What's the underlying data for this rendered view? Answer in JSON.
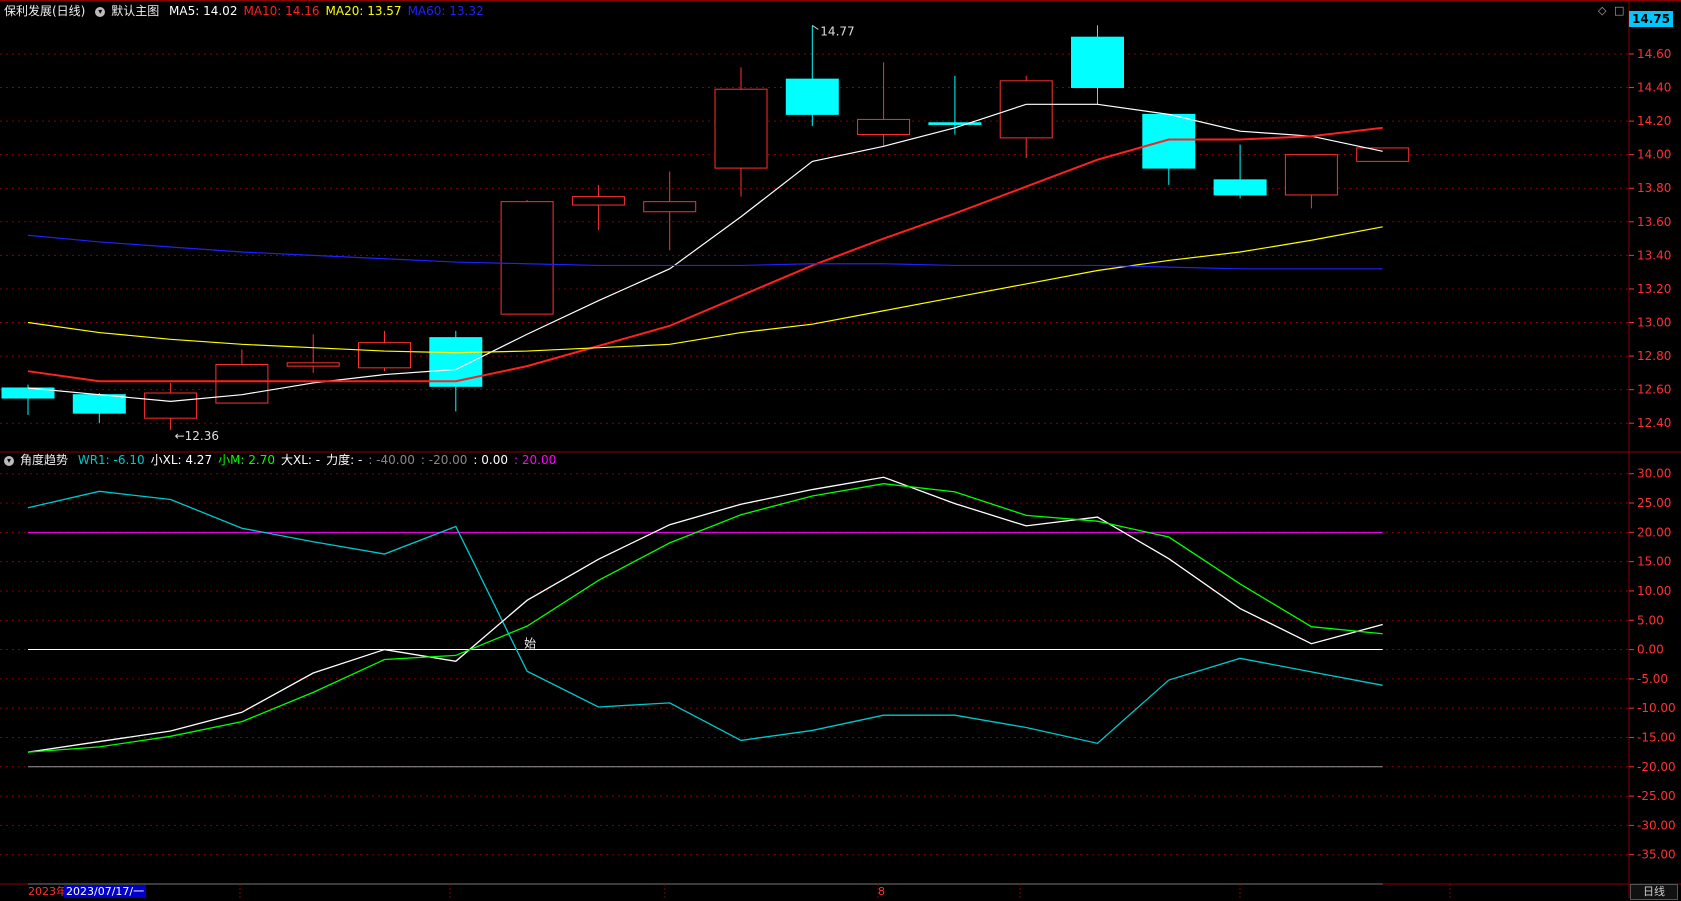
{
  "main_panel": {
    "title": "保利发展(日线)",
    "template_label": "默认主图",
    "indicators": [
      {
        "label": "MA5: 14.02",
        "color": "#ffffff"
      },
      {
        "label": "MA10: 14.16",
        "color": "#ff2020"
      },
      {
        "label": "MA20: 13.57",
        "color": "#ffff00"
      },
      {
        "label": "MA60: 13.32",
        "color": "#2020ff"
      }
    ],
    "price_tag": "14.75",
    "high_marker": "14.77",
    "low_marker": "12.36"
  },
  "sub_panel": {
    "title": "角度趋势",
    "indicators": [
      {
        "label": "WR1: -6.10",
        "color": "#00c8c8"
      },
      {
        "label": "小XL: 4.27",
        "color": "#ffffff"
      },
      {
        "label": "小M: 2.70",
        "color": "#00ff00"
      },
      {
        "label": "大XL: -",
        "color": "#ffffff"
      },
      {
        "label": "力度: -",
        "color": "#ffffff"
      },
      {
        "label": ": -40.00",
        "color": "#888888"
      },
      {
        "label": ": -20.00",
        "color": "#888888"
      },
      {
        "label": ": 0.00",
        "color": "#ffffff"
      },
      {
        "label": ": 20.00",
        "color": "#ff00ff"
      }
    ],
    "start_marker": "始"
  },
  "bottom": {
    "year": "2023年",
    "selected_date": "2023/07/17/一",
    "month_marker": "8",
    "tab": "日线"
  },
  "colors": {
    "up": "#ff3030",
    "down": "#00ffff",
    "grid": "#8b0000",
    "axis_text": "#ff3030"
  },
  "chart_data": [
    {
      "type": "candlestick",
      "title": "保利发展(日线)",
      "ylim": [
        12.3,
        14.85
      ],
      "yticks": [
        12.4,
        12.6,
        12.8,
        13.0,
        13.2,
        13.4,
        13.6,
        13.8,
        14.0,
        14.2,
        14.4,
        14.6
      ],
      "ytick_labels": [
        "12.40",
        "12.60",
        "12.80",
        "13.00",
        "13.20",
        "13.40",
        "13.60",
        "13.80",
        "14.00",
        "14.20",
        "14.40",
        "14.60"
      ],
      "candles": [
        {
          "o": 12.61,
          "h": 12.63,
          "l": 12.45,
          "c": 12.55
        },
        {
          "o": 12.57,
          "h": 12.58,
          "l": 12.4,
          "c": 12.46
        },
        {
          "o": 12.43,
          "h": 12.64,
          "l": 12.36,
          "c": 12.58
        },
        {
          "o": 12.52,
          "h": 12.84,
          "l": 12.52,
          "c": 12.75
        },
        {
          "o": 12.74,
          "h": 12.93,
          "l": 12.7,
          "c": 12.76
        },
        {
          "o": 12.73,
          "h": 12.95,
          "l": 12.71,
          "c": 12.88
        },
        {
          "o": 12.91,
          "h": 12.95,
          "l": 12.47,
          "c": 12.62
        },
        {
          "o": 13.05,
          "h": 13.73,
          "l": 13.05,
          "c": 13.72
        },
        {
          "o": 13.7,
          "h": 13.82,
          "l": 13.55,
          "c": 13.75
        },
        {
          "o": 13.66,
          "h": 13.9,
          "l": 13.43,
          "c": 13.72
        },
        {
          "o": 13.92,
          "h": 14.52,
          "l": 13.75,
          "c": 14.39
        },
        {
          "o": 14.45,
          "h": 14.77,
          "l": 14.17,
          "c": 14.24
        },
        {
          "o": 14.12,
          "h": 14.55,
          "l": 14.05,
          "c": 14.21
        },
        {
          "o": 14.19,
          "h": 14.47,
          "l": 14.12,
          "c": 14.18
        },
        {
          "o": 14.1,
          "h": 14.47,
          "l": 13.98,
          "c": 14.44
        },
        {
          "o": 14.7,
          "h": 14.77,
          "l": 14.3,
          "c": 14.4
        },
        {
          "o": 14.24,
          "h": 14.24,
          "l": 13.82,
          "c": 13.92
        },
        {
          "o": 13.85,
          "h": 14.06,
          "l": 13.74,
          "c": 13.76
        },
        {
          "o": 13.76,
          "h": 14.0,
          "l": 13.68,
          "c": 14.0
        },
        {
          "o": 13.96,
          "h": 14.04,
          "l": 13.96,
          "c": 14.04
        }
      ],
      "series": [
        {
          "name": "MA5",
          "color": "#ffffff",
          "values": [
            12.61,
            12.57,
            12.53,
            12.57,
            12.64,
            12.69,
            12.72,
            12.93,
            13.13,
            13.32,
            13.63,
            13.96,
            14.05,
            14.16,
            14.3,
            14.3,
            14.24,
            14.14,
            14.11,
            14.02
          ]
        },
        {
          "name": "MA10",
          "color": "#ff2020",
          "values": [
            12.71,
            12.65,
            12.65,
            12.65,
            12.65,
            12.65,
            12.65,
            12.74,
            12.86,
            12.98,
            13.16,
            13.34,
            13.5,
            13.65,
            13.81,
            13.97,
            14.09,
            14.09,
            14.11,
            14.16
          ]
        },
        {
          "name": "MA20",
          "color": "#ffff00",
          "values": [
            13.0,
            12.94,
            12.9,
            12.87,
            12.85,
            12.83,
            12.82,
            12.83,
            12.85,
            12.87,
            12.94,
            12.99,
            13.07,
            13.15,
            13.23,
            13.31,
            13.37,
            13.42,
            13.49,
            13.57
          ]
        },
        {
          "name": "MA60",
          "color": "#2020ff",
          "values": [
            13.52,
            13.48,
            13.45,
            13.42,
            13.4,
            13.38,
            13.36,
            13.35,
            13.34,
            13.34,
            13.34,
            13.35,
            13.35,
            13.34,
            13.34,
            13.34,
            13.33,
            13.32,
            13.32,
            13.32
          ]
        }
      ]
    },
    {
      "type": "line",
      "title": "角度趋势",
      "ylim": [
        -40,
        32
      ],
      "yticks": [
        30,
        25,
        20,
        15,
        10,
        5,
        0,
        -5,
        -10,
        -15,
        -20,
        -25,
        -30,
        -35
      ],
      "ytick_labels": [
        "30.00",
        "25.00",
        "20.00",
        "15.00",
        "10.00",
        "5.00",
        "0.00",
        "-5.00",
        "-10.00",
        "-15.00",
        "-20.00",
        "-25.00",
        "-30.00",
        "-35.00"
      ],
      "hlines": [
        {
          "value": 20,
          "color": "#ff00ff"
        },
        {
          "value": 0,
          "color": "#ffffff"
        },
        {
          "value": -20,
          "color": "#999999"
        },
        {
          "value": -40,
          "color": "#777777"
        }
      ],
      "series": [
        {
          "name": "WR1",
          "color": "#00c8c8",
          "values": [
            24.2,
            27.0,
            25.6,
            20.7,
            18.4,
            16.3,
            21.0,
            -3.7,
            -9.8,
            -9.1,
            -15.5,
            -13.8,
            -11.2,
            -11.2,
            -13.3,
            -16.0,
            -5.2,
            -1.5,
            -3.8,
            -6.1
          ]
        },
        {
          "name": "小XL",
          "color": "#ffffff",
          "values": [
            -17.5,
            -15.7,
            -13.9,
            -10.7,
            -4.0,
            0.0,
            -2.0,
            8.4,
            15.4,
            21.3,
            24.8,
            27.3,
            29.4,
            24.9,
            21.1,
            22.6,
            15.5,
            7.0,
            1.0,
            4.27
          ]
        },
        {
          "name": "小M",
          "color": "#00ff00",
          "values": [
            -17.5,
            -16.6,
            -14.8,
            -12.3,
            -7.3,
            -1.7,
            -1.0,
            4.0,
            11.8,
            18.2,
            23.0,
            26.2,
            28.3,
            26.9,
            22.9,
            21.9,
            19.2,
            11.2,
            3.9,
            2.7
          ]
        }
      ]
    }
  ]
}
